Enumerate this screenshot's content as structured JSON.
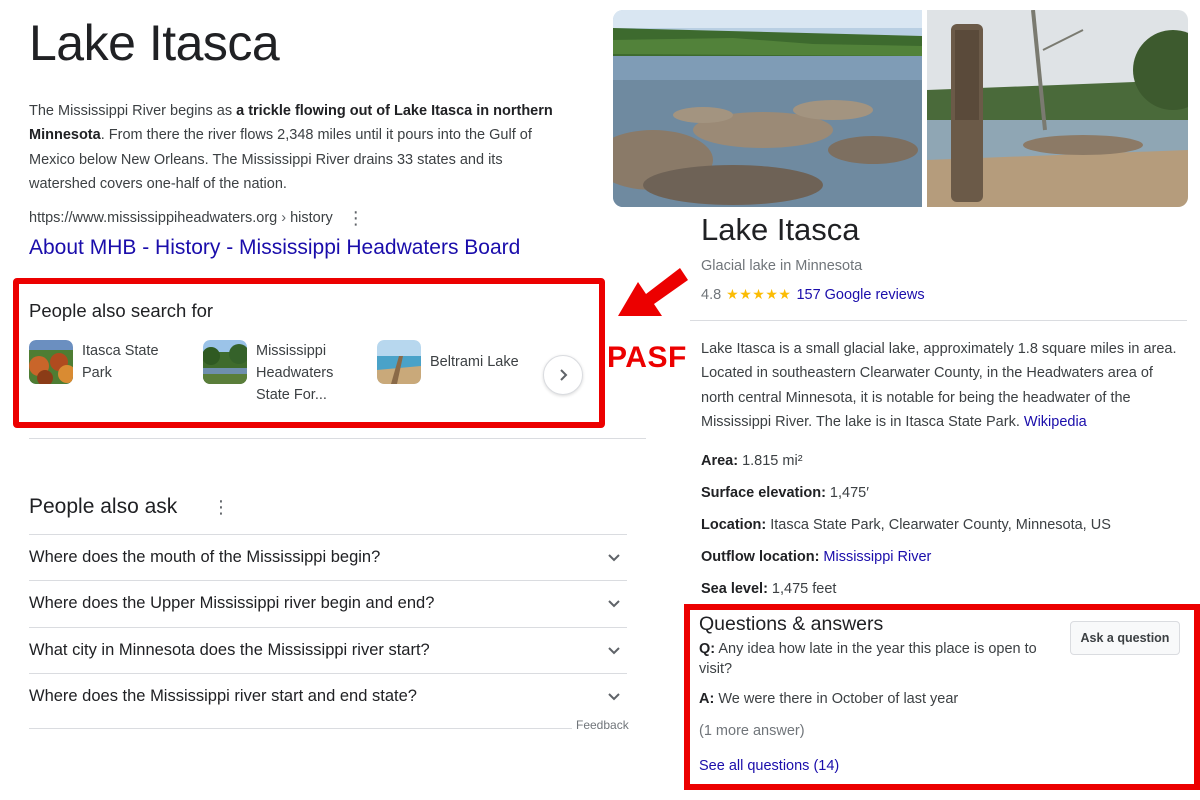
{
  "result": {
    "title": "Lake Itasca",
    "snippet_pre": "The Mississippi River begins as ",
    "snippet_bold": "a trickle flowing out of Lake Itasca in northern Minnesota",
    "snippet_post": ". From there the river flows 2,348 miles until it pours into the Gulf of Mexico below New Orleans. The Mississippi River drains 33 states and its watershed covers one-half of the nation.",
    "cite_url": "https://www.mississippiheadwaters.org",
    "cite_path": "history",
    "cite_sep": "›",
    "more_icon": "⋮",
    "link_text": "About MHB - History - Mississippi Headwaters Board"
  },
  "pasf": {
    "title": "People also search for",
    "tag": "PASF",
    "items": [
      {
        "label": "Itasca State Park"
      },
      {
        "label": "Mississippi Headwaters State For..."
      },
      {
        "label": "Beltrami Lake"
      }
    ],
    "next_icon": "chevron-right-icon"
  },
  "paa": {
    "title": "People also ask",
    "more_icon": "⋮",
    "questions": [
      "Where does the mouth of the Mississippi begin?",
      "Where does the Upper Mississippi river begin and end?",
      "What city in Minnesota does the Mississippi river start?",
      "Where does the Mississippi river start and end state?"
    ],
    "feedback": "Feedback"
  },
  "knowledge_panel": {
    "title": "Lake Itasca",
    "subtitle": "Glacial lake in Minnesota",
    "rating": "4.8",
    "stars": "★★★★★",
    "reviews": "157 Google reviews",
    "description": "Lake Itasca is a small glacial lake, approximately 1.8 square miles in area. Located in southeastern Clearwater County, in the Headwaters area of north central Minnesota, it is notable for being the headwater of the Mississippi River. The lake is in Itasca State Park. ",
    "description_source": "Wikipedia",
    "facts": [
      {
        "label": "Area:",
        "value": "1.815 mi²"
      },
      {
        "label": "Surface elevation:",
        "value": "1,475′"
      },
      {
        "label": "Location:",
        "value": "Itasca State Park, Clearwater County, Minnesota, US"
      },
      {
        "label": "Outflow location:",
        "value": "Mississippi River"
      },
      {
        "label": "Sea level:",
        "value": "1,475 feet"
      }
    ]
  },
  "qa": {
    "title": "Questions & answers",
    "ask_button": "Ask a question",
    "q_prefix": "Q:",
    "question": "Any idea how late in the year this place is open to visit?",
    "a_prefix": "A:",
    "answer": "We were there in October of last year",
    "more_answers": "(1 more answer)",
    "see_all": "See all questions (14)"
  },
  "colors": {
    "highlight_red": "#ec0000",
    "link_blue": "#1a0dab",
    "star_yellow": "#fbbc04",
    "text_gray": "#70757a"
  }
}
